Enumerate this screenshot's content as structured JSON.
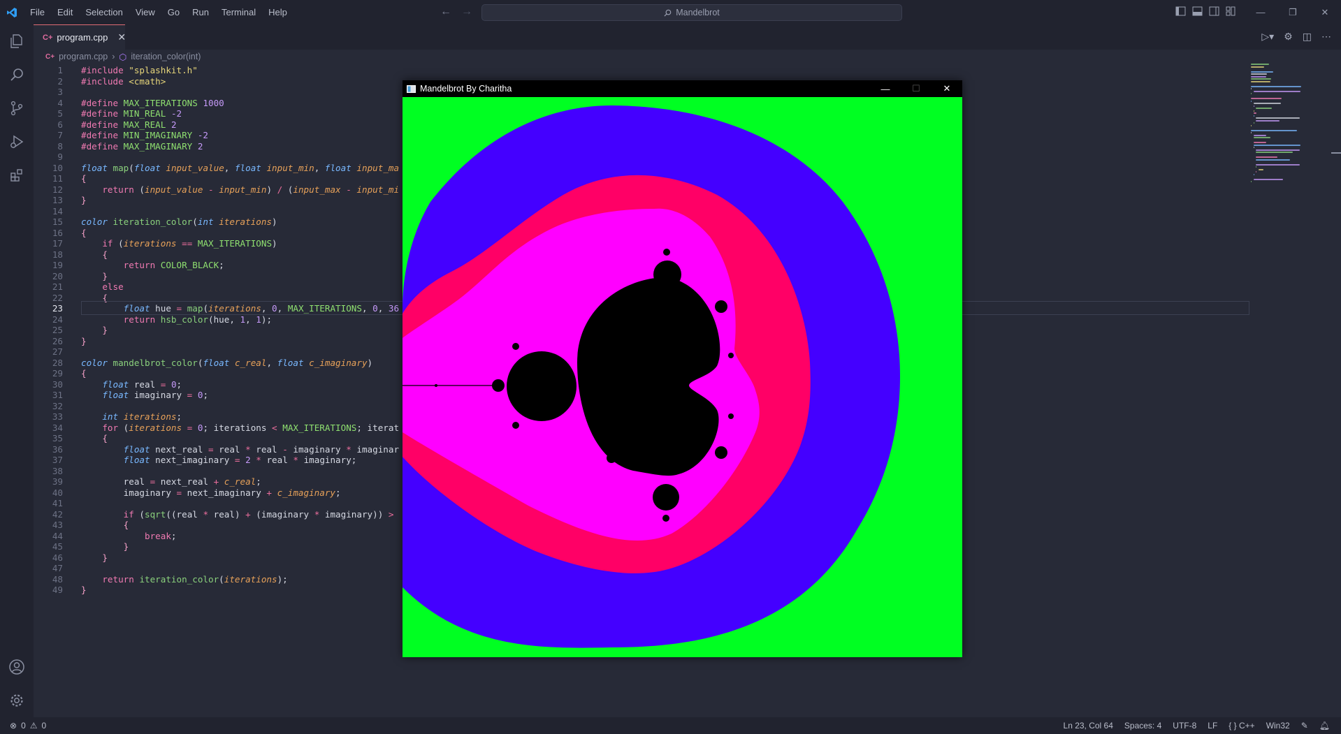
{
  "app": {
    "menu": [
      "File",
      "Edit",
      "Selection",
      "View",
      "Go",
      "Run",
      "Terminal",
      "Help"
    ],
    "search_text": "Mandelbrot"
  },
  "tab": {
    "filename": "program.cpp"
  },
  "breadcrumb": {
    "file": "program.cpp",
    "symbol": "iteration_color(int)"
  },
  "editor": {
    "active_line": 23,
    "lines": [
      {
        "n": "1"
      },
      {
        "n": "2"
      },
      {
        "n": "3"
      },
      {
        "n": "4"
      },
      {
        "n": "5"
      },
      {
        "n": "6"
      },
      {
        "n": "7"
      },
      {
        "n": "8"
      },
      {
        "n": "9"
      },
      {
        "n": "10"
      },
      {
        "n": "11"
      },
      {
        "n": "12"
      },
      {
        "n": "13"
      },
      {
        "n": "14"
      },
      {
        "n": "15"
      },
      {
        "n": "16"
      },
      {
        "n": "17"
      },
      {
        "n": "18"
      },
      {
        "n": "19"
      },
      {
        "n": "20"
      },
      {
        "n": "21"
      },
      {
        "n": "22"
      },
      {
        "n": "23"
      },
      {
        "n": "24"
      },
      {
        "n": "25"
      },
      {
        "n": "26"
      },
      {
        "n": "27"
      },
      {
        "n": "28"
      },
      {
        "n": "29"
      },
      {
        "n": "30"
      },
      {
        "n": "31"
      },
      {
        "n": "32"
      },
      {
        "n": "33"
      },
      {
        "n": "34"
      },
      {
        "n": "35"
      },
      {
        "n": "36"
      },
      {
        "n": "37"
      },
      {
        "n": "38"
      },
      {
        "n": "39"
      },
      {
        "n": "40"
      },
      {
        "n": "41"
      },
      {
        "n": "42"
      },
      {
        "n": "43"
      },
      {
        "n": "44"
      },
      {
        "n": "45"
      },
      {
        "n": "46"
      },
      {
        "n": "47"
      },
      {
        "n": "48"
      },
      {
        "n": "49"
      }
    ],
    "code": [
      "#include \"splashkit.h\"",
      "#include <cmath>",
      "",
      "#define MAX_ITERATIONS 1000",
      "#define MIN_REAL -2",
      "#define MAX_REAL 2",
      "#define MIN_IMAGINARY -2",
      "#define MAX_IMAGINARY 2",
      "",
      "float map(float input_value, float input_min, float input_ma",
      "{",
      "    return (input_value - input_min) / (input_max - input_mi",
      "}",
      "",
      "color iteration_color(int iterations)",
      "{",
      "    if (iterations == MAX_ITERATIONS)",
      "    {",
      "        return COLOR_BLACK;",
      "    }",
      "    else",
      "    {",
      "        float hue = map(iterations, 0, MAX_ITERATIONS, 0, 36",
      "        return hsb_color(hue, 1, 1);",
      "    }",
      "}",
      "",
      "color mandelbrot_color(float c_real, float c_imaginary)",
      "{",
      "    float real = 0;",
      "    float imaginary = 0;",
      "",
      "    int iterations;",
      "    for (iterations = 0; iterations < MAX_ITERATIONS; iterat",
      "    {",
      "        float next_real = real * real - imaginary * imaginar",
      "        float next_imaginary = 2 * real * imaginary;",
      "",
      "        real = next_real + c_real;",
      "        imaginary = next_imaginary + c_imaginary;",
      "",
      "        if (sqrt((real * real) + (imaginary * imaginary)) > ",
      "        {",
      "            break;",
      "        }",
      "    }",
      "",
      "    return iteration_color(iterations);",
      "}"
    ]
  },
  "mandel_window": {
    "title": "Mandelbrot By Charitha",
    "colors": {
      "outer": "#00ff22",
      "band1": "#4400ff",
      "band2": "#ff0066",
      "band3": "#ff00ff",
      "set": "#000000"
    }
  },
  "status": {
    "errors": "0",
    "warnings": "0",
    "position": "Ln 23, Col 64",
    "spaces": "Spaces: 4",
    "encoding": "UTF-8",
    "eol": "LF",
    "language": "C++",
    "platform": "Win32"
  },
  "icons": [
    "vscode-logo-icon",
    "explorer-icon",
    "search-icon",
    "source-control-icon",
    "run-debug-icon",
    "extensions-icon",
    "account-icon",
    "settings-gear-icon"
  ]
}
